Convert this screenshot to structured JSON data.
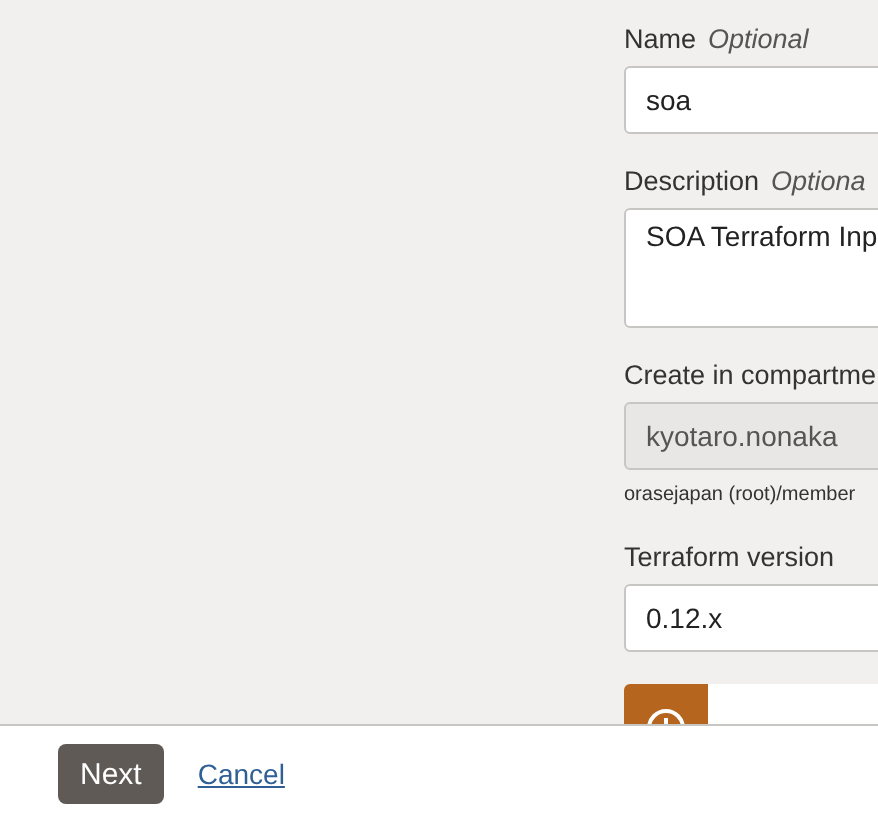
{
  "form": {
    "fields": [
      {
        "kind": "input",
        "label": "Name",
        "hint": "Optional",
        "value": "soa",
        "disabled": false
      },
      {
        "kind": "textarea",
        "label": "Description",
        "hint": "Optiona",
        "value": "SOA Terraform Inp",
        "disabled": false
      },
      {
        "kind": "input",
        "label": "Create in compartme",
        "value": "kyotaro.nonaka",
        "disabled": true,
        "note": "orasejapan (root)/member"
      },
      {
        "kind": "select",
        "label": "Terraform version",
        "value": "0.12.x",
        "disabled": false
      }
    ],
    "banner": {
      "kind": "warning"
    }
  },
  "footer": {
    "buttons": [
      {
        "kind": "primary",
        "label": "Next"
      },
      {
        "kind": "link",
        "label": "Cancel"
      }
    ]
  }
}
